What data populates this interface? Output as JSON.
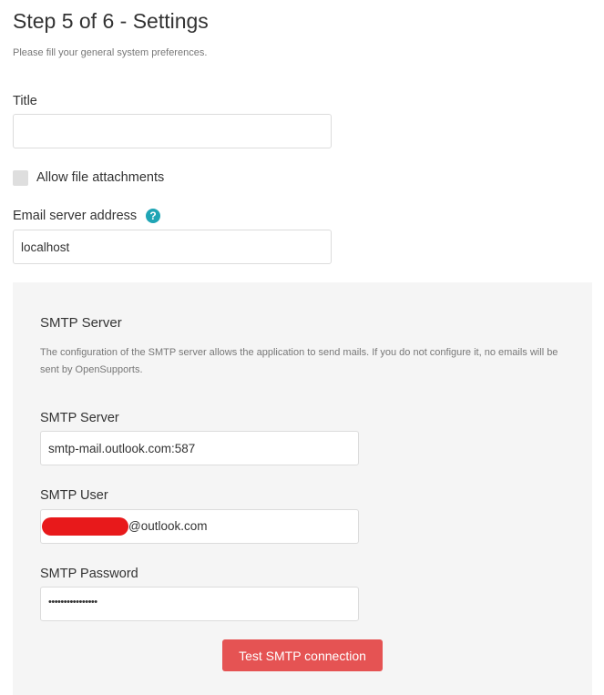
{
  "header": {
    "title": "Step 5 of 6 - Settings",
    "subtitle": "Please fill your general system preferences."
  },
  "form": {
    "title_label": "Title",
    "title_value": "",
    "attachments_label": "Allow file attachments",
    "attachments_checked": false,
    "email_server_label": "Email server address",
    "email_server_value": "localhost",
    "help_icon": "question-circle-icon"
  },
  "smtp": {
    "heading": "SMTP Server",
    "description": "The configuration of the SMTP server allows the application to send mails. If you do not configure it, no emails will be sent by OpenSupports.",
    "server_label": "SMTP Server",
    "server_value": "smtp-mail.outlook.com:587",
    "user_label": "SMTP User",
    "user_value_visible": "@outlook.com",
    "password_label": "SMTP Password",
    "password_value": "••••••••••••••••",
    "test_button": "Test SMTP connection"
  },
  "colors": {
    "accent": "#e55353",
    "help_icon": "#1fa5b5",
    "redaction": "#e8191b",
    "panel_bg": "#f5f5f5"
  }
}
